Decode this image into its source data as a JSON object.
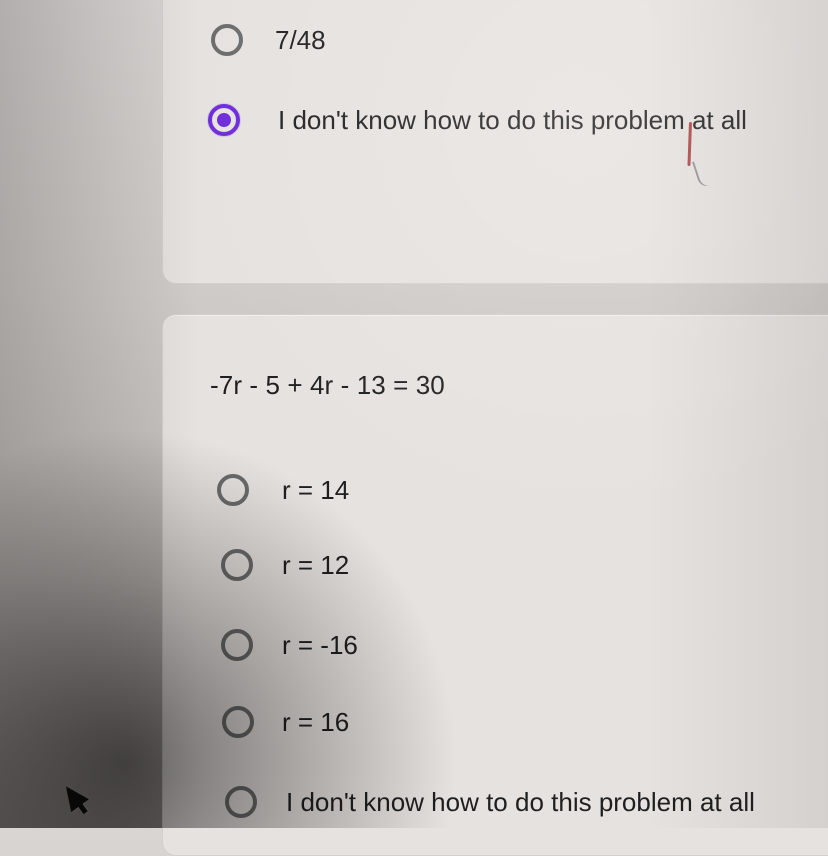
{
  "top_card": {
    "options": [
      {
        "label": "7/48",
        "selected": false
      },
      {
        "label": "I don't know how to do this problem at all",
        "selected": true
      }
    ]
  },
  "bottom_card": {
    "question": "-7r - 5 + 4r - 13 = 30",
    "options": [
      {
        "label": "r = 14",
        "selected": false
      },
      {
        "label": "r = 12",
        "selected": false
      },
      {
        "label": "r = -16",
        "selected": false
      },
      {
        "label": "r = 16",
        "selected": false
      },
      {
        "label": "I don't know how to do this problem at all",
        "selected": false
      }
    ]
  },
  "icons": {
    "radio_unselected": "radio-button-unselected-icon",
    "radio_selected": "radio-button-selected-icon",
    "cursor": "mouse-cursor-icon"
  },
  "colors": {
    "selected_radio": "#6c2bd9",
    "unselected_radio": "#6b6b6b",
    "text": "#1f1f1f",
    "card_background": "#e6e2df"
  }
}
